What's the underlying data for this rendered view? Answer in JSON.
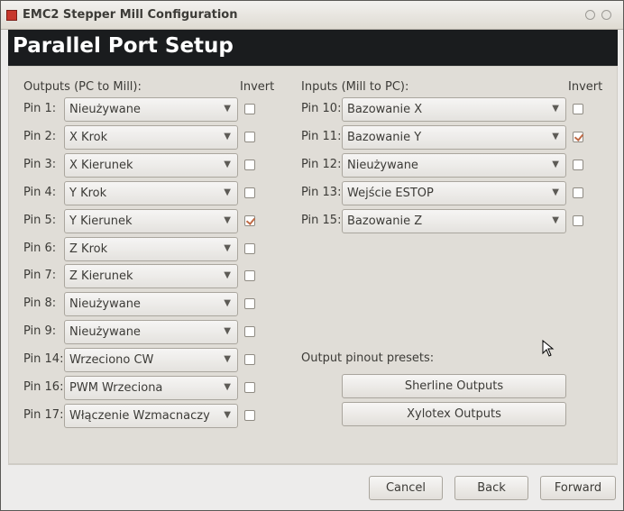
{
  "window": {
    "title": "EMC2 Stepper Mill Configuration",
    "banner": "Parallel Port Setup"
  },
  "outputs": {
    "header": "Outputs (PC to Mill):",
    "invert_header": "Invert",
    "pins": [
      {
        "label": "Pin 1:",
        "value": "Nieużywane",
        "invert": false
      },
      {
        "label": "Pin 2:",
        "value": "X Krok",
        "invert": false
      },
      {
        "label": "Pin 3:",
        "value": "X Kierunek",
        "invert": false
      },
      {
        "label": "Pin 4:",
        "value": "Y Krok",
        "invert": false
      },
      {
        "label": "Pin 5:",
        "value": "Y Kierunek",
        "invert": true
      },
      {
        "label": "Pin 6:",
        "value": "Z Krok",
        "invert": false
      },
      {
        "label": "Pin 7:",
        "value": "Z Kierunek",
        "invert": false
      },
      {
        "label": "Pin 8:",
        "value": "Nieużywane",
        "invert": false
      },
      {
        "label": "Pin 9:",
        "value": "Nieużywane",
        "invert": false
      },
      {
        "label": "Pin 14:",
        "value": "Wrzeciono CW",
        "invert": false
      },
      {
        "label": "Pin 16:",
        "value": "PWM Wrzeciona",
        "invert": false
      },
      {
        "label": "Pin 17:",
        "value": "Włączenie Wzmacnaczy",
        "invert": false
      }
    ]
  },
  "inputs": {
    "header": "Inputs (Mill to PC):",
    "invert_header": "Invert",
    "pins": [
      {
        "label": "Pin 10:",
        "value": "Bazowanie X",
        "invert": false
      },
      {
        "label": "Pin 11:",
        "value": "Bazowanie Y",
        "invert": true
      },
      {
        "label": "Pin 12:",
        "value": "Nieużywane",
        "invert": false
      },
      {
        "label": "Pin 13:",
        "value": "Wejście ESTOP",
        "invert": false
      },
      {
        "label": "Pin 15:",
        "value": "Bazowanie Z",
        "invert": false
      }
    ]
  },
  "presets": {
    "label": "Output pinout presets:",
    "sherline": "Sherline Outputs",
    "xylotex": "Xylotex Outputs"
  },
  "footer": {
    "cancel": "Cancel",
    "back": "Back",
    "forward": "Forward"
  },
  "icons": {
    "combo_arrow": "▼"
  }
}
